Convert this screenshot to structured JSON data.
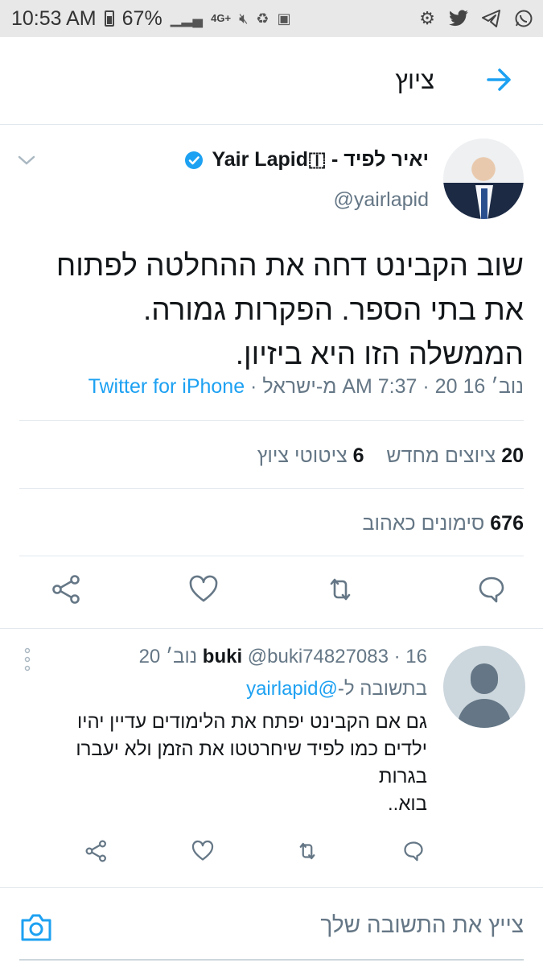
{
  "status_bar": {
    "time": "10:53 AM",
    "battery": "67%",
    "network": "4G+",
    "icons": [
      "battery-icon",
      "signal-icon",
      "mute-icon",
      "recycle-icon",
      "sim-icon",
      "settings-icon",
      "twitter-icon",
      "telegram-icon",
      "whatsapp-icon"
    ]
  },
  "header": {
    "title": "ציוץ"
  },
  "tweet": {
    "author_name": "יאיר לפיד - Yair Lapid🇮",
    "handle": "@yairlapid",
    "text": "שוב הקבינט דחה את ההחלטה לפתוח את בתי הספר. הפקרות גמורה. הממשלה הזו היא ביזיון.",
    "meta_prefix": "נוב׳ 16 20 · 7:37 AM מ-ישראל · ",
    "source": "Twitter for iPhone",
    "retweets_count": "20",
    "retweets_label": "ציוצים מחדש",
    "quotes_count": "6",
    "quotes_label": "ציטוטי ציוץ",
    "likes_count": "676",
    "likes_label": "סימונים כאהוב"
  },
  "reply": {
    "name": "buki",
    "handle_date": " @buki74827083 · 16 נוב׳ 20",
    "reply_to_label": "בתשובה ל-",
    "reply_to_handle": "@yairlapid",
    "text_line1": "גם אם הקבינט יפתח את הלימודים עדיין יהיו",
    "text_line2": "ילדים כמו לפיד שיחרטטו את הזמן ולא יעברו",
    "text_line3": "בגרות",
    "text_line4": "בוא.."
  },
  "composer": {
    "placeholder": "צייץ את התשובה שלך"
  },
  "colors": {
    "accent": "#1da1f2",
    "secondary_text": "#657786",
    "verified": "#1da1f2"
  }
}
